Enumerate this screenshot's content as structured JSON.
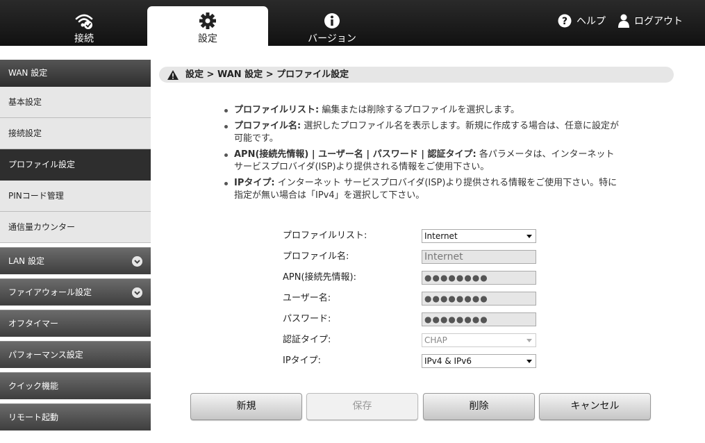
{
  "nav": {
    "tabs": [
      {
        "label": "接続"
      },
      {
        "label": "設定"
      },
      {
        "label": "バージョン"
      }
    ],
    "help": "ヘルプ",
    "logout": "ログアウト"
  },
  "sidebar": {
    "wan_header": "WAN 設定",
    "wan_items": [
      "基本設定",
      "接続設定",
      "プロファイル設定",
      "PINコード管理",
      "通信量カウンター"
    ],
    "items": [
      "LAN 設定",
      "ファイアウォール設定",
      "オフタイマー",
      "パフォーマンス設定",
      "クイック機能",
      "リモート起動"
    ]
  },
  "breadcrumb": "設定 > WAN 設定 > プロファイル設定",
  "help": [
    {
      "term": "プロファイルリスト:",
      "desc": "編集または削除するプロファイルを選択します。"
    },
    {
      "term": "プロファイル名:",
      "desc": "選択したプロファイル名を表示します。新規に作成する場合は、任意に設定が可能です。"
    },
    {
      "term": "APN(接続先情報) | ユーザー名 | パスワード | 認証タイプ:",
      "desc": "各パラメータは、インターネット サービスプロバイダ(ISP)より提供される情報をご使用下さい。"
    },
    {
      "term": "IPタイプ:",
      "desc": "インターネット サービスプロバイダ(ISP)より提供される情報をご使用下さい。特に指定が無い場合は「IPv4」を選択して下さい。"
    }
  ],
  "form": {
    "profile_list": {
      "label": "プロファイルリスト:",
      "value": "Internet"
    },
    "profile_name": {
      "label": "プロファイル名:",
      "value": "Internet"
    },
    "apn": {
      "label": "APN(接続先情報):",
      "value": "●●●●●●●●"
    },
    "username": {
      "label": "ユーザー名:",
      "value": "●●●●●●●●"
    },
    "password": {
      "label": "パスワード:",
      "value": "●●●●●●●●"
    },
    "auth_type": {
      "label": "認証タイプ:",
      "value": "CHAP"
    },
    "ip_type": {
      "label": "IPタイプ:",
      "value": "IPv4 & IPv6"
    }
  },
  "buttons": {
    "new": "新規",
    "save": "保存",
    "delete": "削除",
    "cancel": "キャンセル"
  }
}
